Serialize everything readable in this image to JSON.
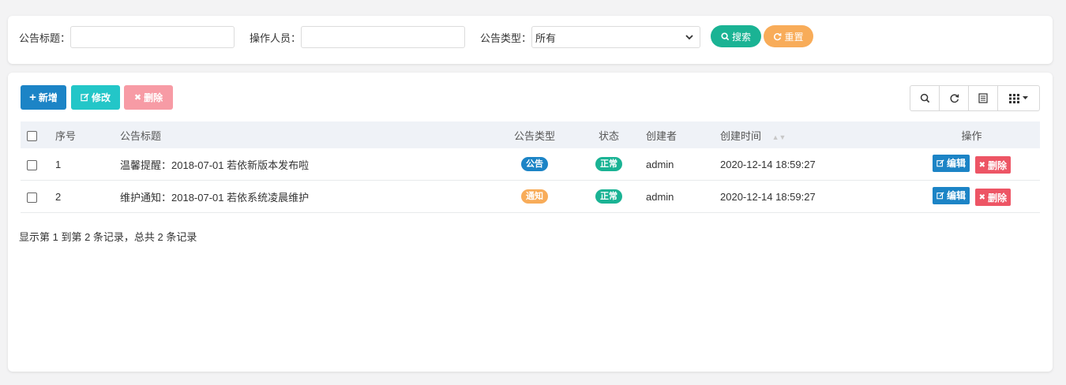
{
  "search": {
    "title_label": "公告标题：",
    "title_value": "",
    "operator_label": "操作人员：",
    "operator_value": "",
    "type_label": "公告类型：",
    "type_selected": "所有",
    "search_button": "搜索",
    "reset_button": "重置"
  },
  "toolbar": {
    "add_label": "新增",
    "edit_label": "修改",
    "delete_label": "删除"
  },
  "table": {
    "headers": {
      "index": "序号",
      "title": "公告标题",
      "type": "公告类型",
      "status": "状态",
      "creator": "创建者",
      "created_at": "创建时间",
      "actions": "操作"
    },
    "rows": [
      {
        "index": "1",
        "title": "温馨提醒：2018-07-01 若依新版本发布啦",
        "type": "公告",
        "status": "正常",
        "creator": "admin",
        "created_at": "2020-12-14 18:59:27",
        "edit": "编辑",
        "delete": "删除"
      },
      {
        "index": "2",
        "title": "维护通知：2018-07-01 若依系统凌晨维护",
        "type": "通知",
        "status": "正常",
        "creator": "admin",
        "created_at": "2020-12-14 18:59:27",
        "edit": "编辑",
        "delete": "删除"
      }
    ]
  },
  "pagination": {
    "summary": "显示第 1 到第 2 条记录，总共 2 条记录"
  },
  "colors": {
    "green": "#1ab394",
    "orange": "#f8ac59",
    "blue": "#1c84c6",
    "red": "#ed5565"
  },
  "icons": [
    "search-icon",
    "refresh-icon",
    "plus-icon",
    "edit-icon",
    "close-icon",
    "toggle-view-icon",
    "columns-icon",
    "chevron-down-icon",
    "sort-icon"
  ]
}
